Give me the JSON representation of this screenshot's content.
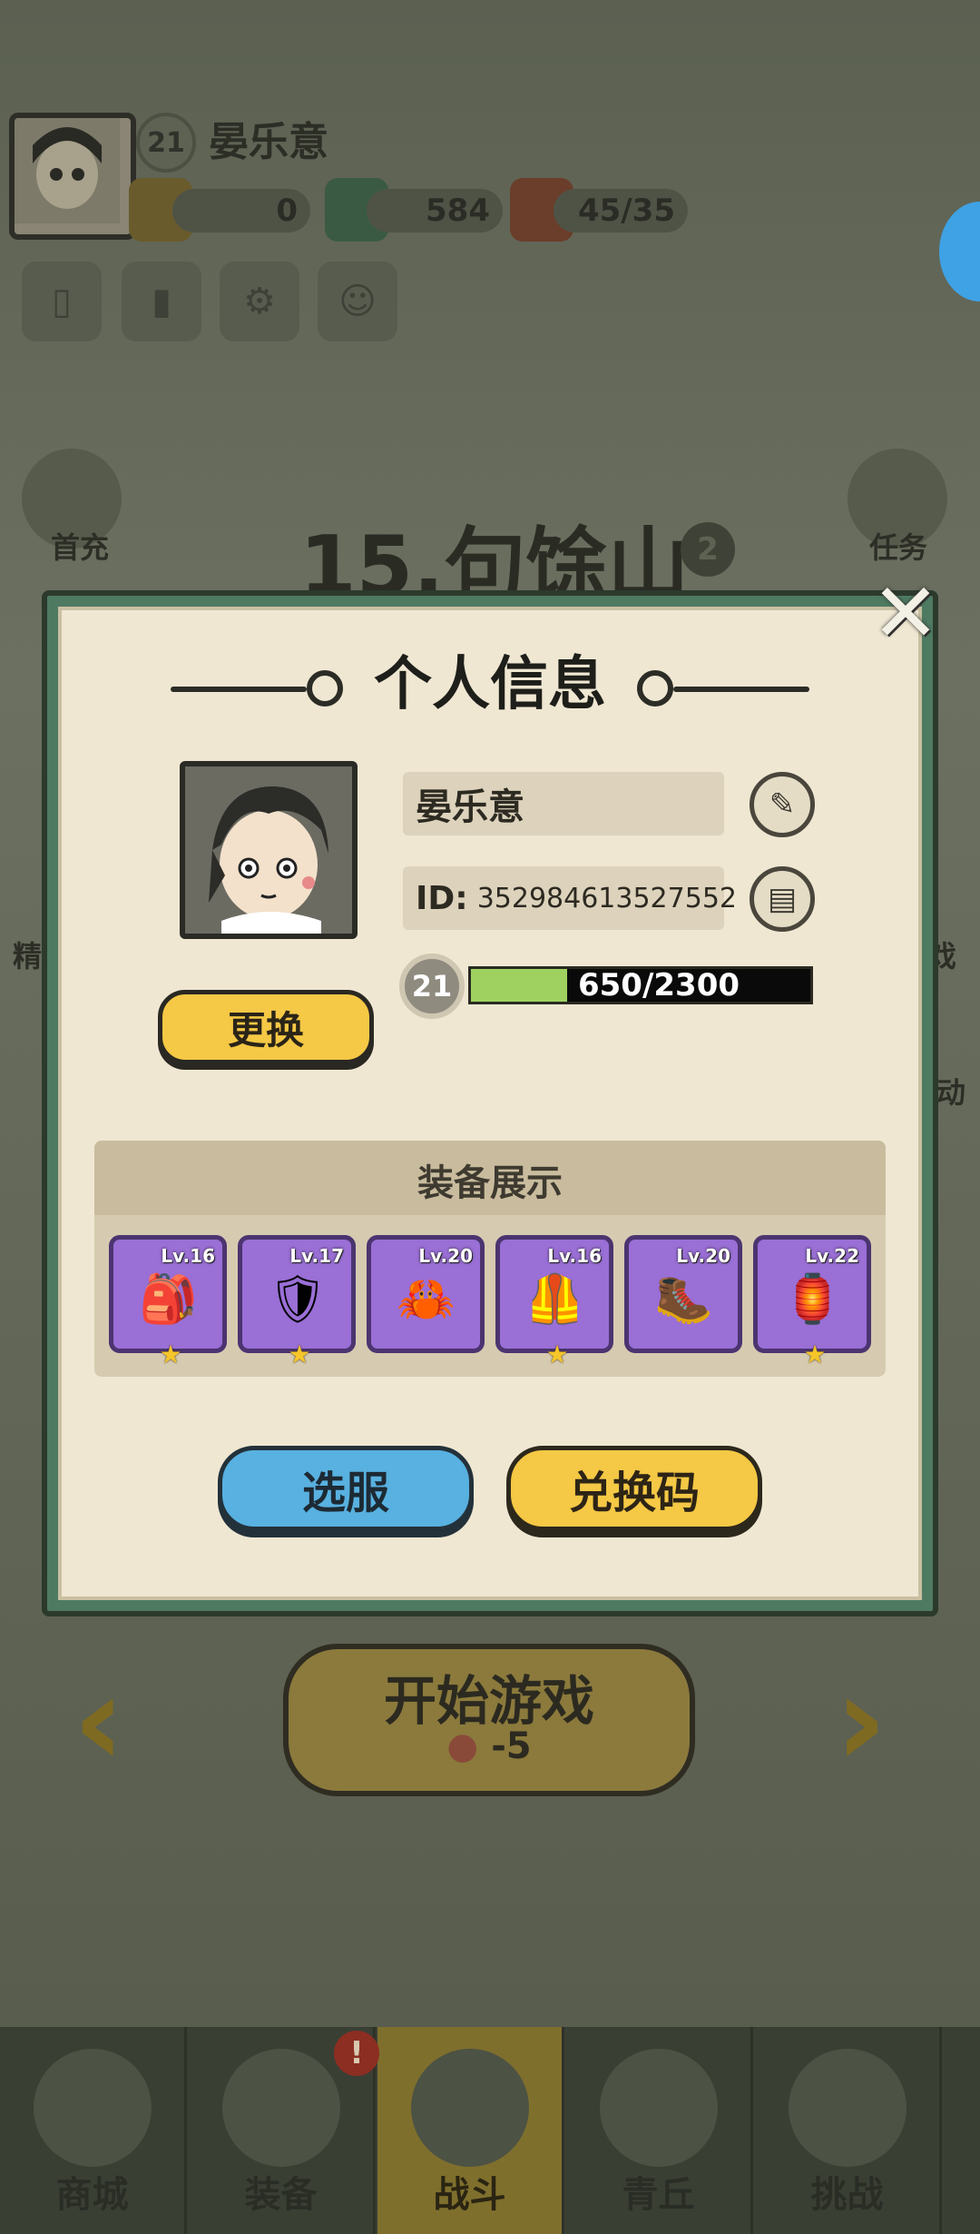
{
  "hud": {
    "level": "21",
    "player_name": "晏乐意",
    "resources": [
      {
        "name": "tickets",
        "value": "0"
      },
      {
        "name": "jade",
        "value": "584"
      },
      {
        "name": "stamina",
        "value": "45/35"
      }
    ],
    "buttons": [
      "card-icon",
      "ranking-icon",
      "settings-icon",
      "friends-icon"
    ]
  },
  "side": {
    "first_recharge": "首充",
    "tasks": "任务",
    "left_partial": "精",
    "right_partial_1": "戏",
    "right_partial_2": "动"
  },
  "stage": {
    "title": "15.句馀山",
    "badge": "2"
  },
  "dialog": {
    "title": "个人信息",
    "close": "✕",
    "name": "晏乐意",
    "id_label": "ID:",
    "id_value": "352984613527552",
    "level": "21",
    "exp_text": "650/2300",
    "exp_progress": 0.283,
    "change_button": "更换",
    "equip_title": "装备展示",
    "equipment": [
      {
        "level": "Lv.16",
        "icon": "🎒",
        "stars": 1
      },
      {
        "level": "Lv.17",
        "icon": "🛡",
        "stars": 1
      },
      {
        "level": "Lv.20",
        "icon": "🦀",
        "stars": 0
      },
      {
        "level": "Lv.16",
        "icon": "🦺",
        "stars": 1
      },
      {
        "level": "Lv.20",
        "icon": "🥾",
        "stars": 0
      },
      {
        "level": "Lv.22",
        "icon": "🏮",
        "stars": 1
      }
    ],
    "server_button": "选服",
    "redeem_button": "兑换码"
  },
  "start": {
    "label": "开始游戏",
    "cost": "-5"
  },
  "nav": [
    {
      "label": "商城",
      "active": false
    },
    {
      "label": "装备",
      "active": false
    },
    {
      "label": "战斗",
      "active": true
    },
    {
      "label": "青丘",
      "active": false
    },
    {
      "label": "挑战",
      "active": false
    }
  ],
  "nav_badge": "!",
  "colors": {
    "accent_yellow": "#f5c845",
    "accent_blue": "#58b1e0",
    "slot_purple": "#9a6fd6",
    "exp_green": "#9fd160",
    "frame_green": "#4e7a62"
  }
}
